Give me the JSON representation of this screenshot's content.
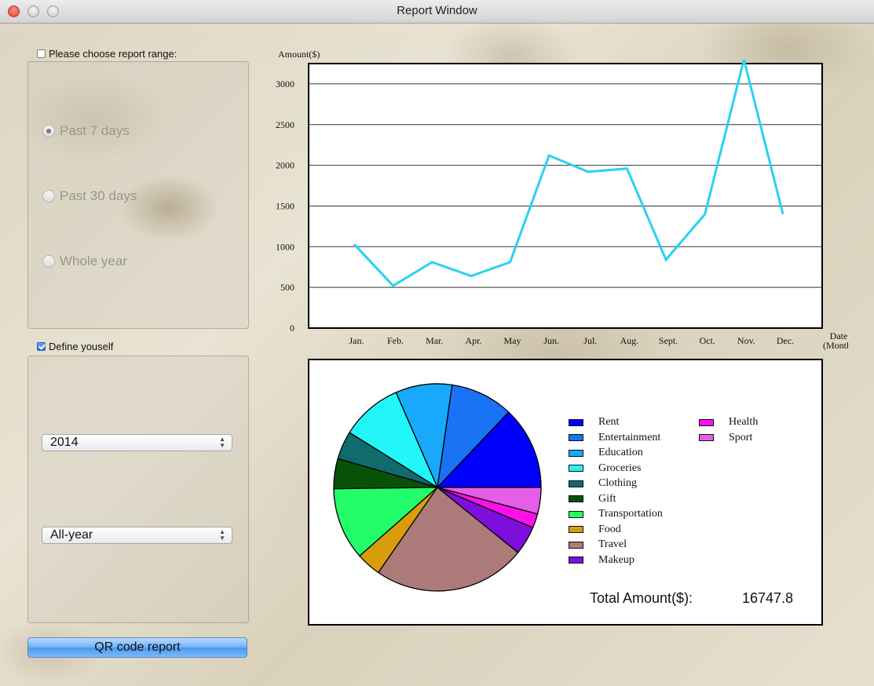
{
  "window": {
    "title": "Report Window"
  },
  "range_panel": {
    "checkbox_label": "Please choose report range:",
    "checked": false,
    "options": [
      {
        "label": "Past 7 days",
        "selected": true
      },
      {
        "label": "Past 30 days",
        "selected": false
      },
      {
        "label": "Whole year",
        "selected": false
      }
    ]
  },
  "define_panel": {
    "checkbox_label": "Define youself",
    "checked": true,
    "year_select": "2014",
    "period_select": "All-year"
  },
  "qr_button": {
    "label": "QR code report"
  },
  "chart_data": [
    {
      "type": "line",
      "title": "",
      "ylabel": "Amount($)",
      "xlabel": [
        "Date",
        "(Month)"
      ],
      "categories": [
        "Jan.",
        "Feb.",
        "Mar.",
        "Apr.",
        "May",
        "Jun.",
        "Jul.",
        "Aug.",
        "Sept.",
        "Oct.",
        "Nov.",
        "Dec."
      ],
      "series": [
        {
          "values": [
            1030,
            520,
            810,
            640,
            810,
            2120,
            1920,
            1960,
            840,
            1400,
            3300,
            1400
          ],
          "color": "#29d2f2"
        }
      ],
      "yticks": [
        0,
        500,
        1000,
        1500,
        2000,
        2500,
        3000
      ],
      "ylim": [
        0,
        3250
      ],
      "grid": true
    },
    {
      "type": "pie",
      "categories": [
        "Rent",
        "Entertainment",
        "Education",
        "Groceries",
        "Clothing",
        "Gift",
        "Transportation",
        "Food",
        "Travel",
        "Makeup",
        "Health",
        "Sport"
      ],
      "values": [
        1880,
        1420,
        1280,
        1390,
        640,
        680,
        1640,
        560,
        3460,
        650,
        320,
        600
      ],
      "colors": [
        "#0000ff",
        "#1a72f5",
        "#19a9fc",
        "#22f6f6",
        "#0f6b6c",
        "#085208",
        "#23fd6a",
        "#d79d0d",
        "#ac7b79",
        "#7f0ddd",
        "#ff10ea",
        "#e55ee8"
      ]
    }
  ],
  "total": {
    "label": "Total Amount($):",
    "value": "16747.8"
  }
}
